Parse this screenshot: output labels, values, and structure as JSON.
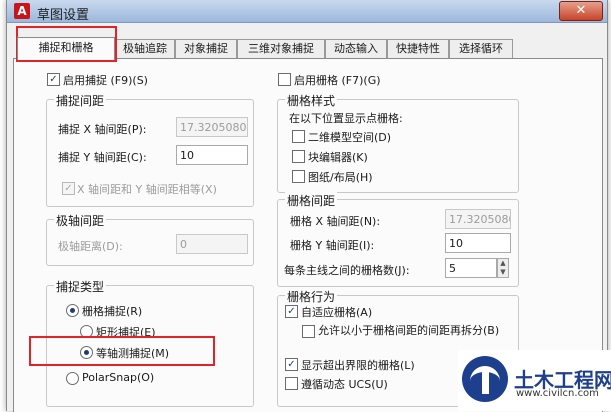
{
  "window": {
    "title": "草图设置",
    "close_glyph": "✕",
    "app_icon_glyph": "A"
  },
  "tabs": [
    {
      "label": "捕捉和栅格",
      "active": true
    },
    {
      "label": "极轴追踪"
    },
    {
      "label": "对象捕捉"
    },
    {
      "label": "三维对象捕捉"
    },
    {
      "label": "动态输入"
    },
    {
      "label": "快捷特性"
    },
    {
      "label": "选择循环"
    }
  ],
  "snap": {
    "enable_label": "启用捕捉 (F9)(S)",
    "enable_checked": true,
    "spacing_group": "捕捉间距",
    "x_label": "捕捉 X 轴间距(P):",
    "x_value": "17.320508076",
    "y_label": "捕捉 Y 轴间距(C):",
    "y_value": "10",
    "equal_label": "X 轴间距和 Y 轴间距相等(X)",
    "equal_checked": true
  },
  "polar": {
    "group": "极轴间距",
    "distance_label": "极轴距离(D):",
    "distance_value": "0"
  },
  "snap_type": {
    "group": "捕捉类型",
    "grid_snap_label": "栅格捕捉(R)",
    "rect_snap_label": "矩形捕捉(E)",
    "iso_snap_label": "等轴测捕捉(M)",
    "polar_snap_label": "PolarSnap(O)",
    "selected": "iso"
  },
  "grid": {
    "enable_label": "启用栅格 (F7)(G)",
    "enable_checked": false,
    "style_group": "栅格样式",
    "style_desc": "在以下位置显示点栅格:",
    "model_space_label": "二维模型空间(D)",
    "block_editor_label": "块编辑器(K)",
    "sheet_layout_label": "图纸/布局(H)",
    "spacing_group": "栅格间距",
    "x_label": "栅格 X 轴间距(N):",
    "x_value": "17.320508076",
    "y_label": "栅格 Y 轴间距(I):",
    "y_value": "10",
    "major_label": "每条主线之间的栅格数(J):",
    "major_value": "5",
    "behavior_group": "栅格行为",
    "adaptive_label": "自适应栅格(A)",
    "adaptive_checked": true,
    "subdivide_label": "允许以小于栅格间距的间距再拆分(B)",
    "subdivide_checked": false,
    "beyond_limits_label": "显示超出界限的栅格(L)",
    "beyond_limits_checked": true,
    "follow_ucs_label": "遵循动态 UCS(U)",
    "follow_ucs_checked": false
  },
  "watermark": {
    "title": "土木工程网",
    "url": "www.civilcn.com"
  },
  "colors": {
    "highlight": "#e2242a",
    "check": "#1e3c7a",
    "brand": "#1d3f8d"
  }
}
